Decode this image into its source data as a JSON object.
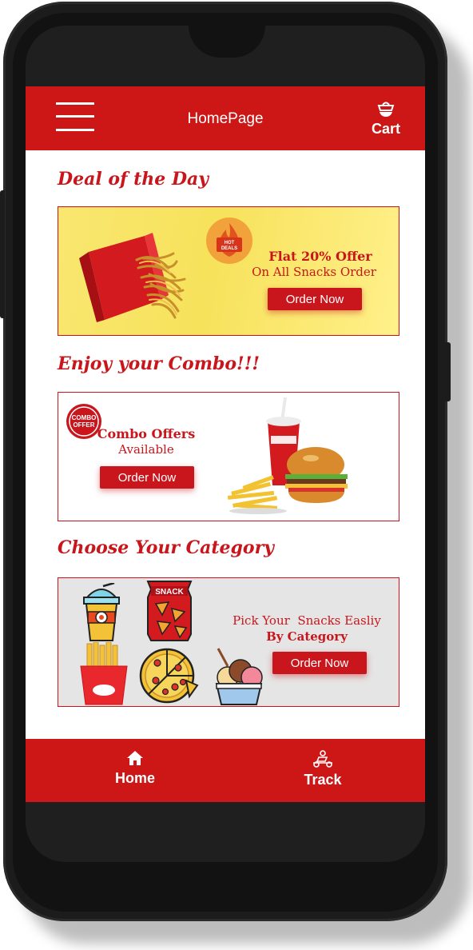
{
  "header": {
    "title": "HomePage",
    "cart_label": "Cart"
  },
  "sections": {
    "deal": {
      "title": "Deal of the Day",
      "badge": "HOT DEALS",
      "headline": "Flat 20% Offer",
      "subline": "On All Snacks Order",
      "button": "Order Now"
    },
    "combo": {
      "title": "Enjoy your Combo!!!",
      "stamp": "COMBO OFFER",
      "headline": "Combo Offers",
      "subline": "Available",
      "button": "Order Now"
    },
    "category": {
      "title": "Choose Your Category",
      "snack_label": "SNACK",
      "line1": "Pick Your  Snacks Easliy",
      "line2": "By Category",
      "button": "Order Now"
    }
  },
  "bottom_nav": [
    {
      "label": "Home",
      "icon": "home-icon"
    },
    {
      "label": "Track",
      "icon": "delivery-scooter-icon"
    }
  ],
  "colors": {
    "primary": "#cd1717",
    "accent_text": "#c8161c",
    "deal_bg": "#f7e25b",
    "category_bg": "#e5e5e5"
  }
}
